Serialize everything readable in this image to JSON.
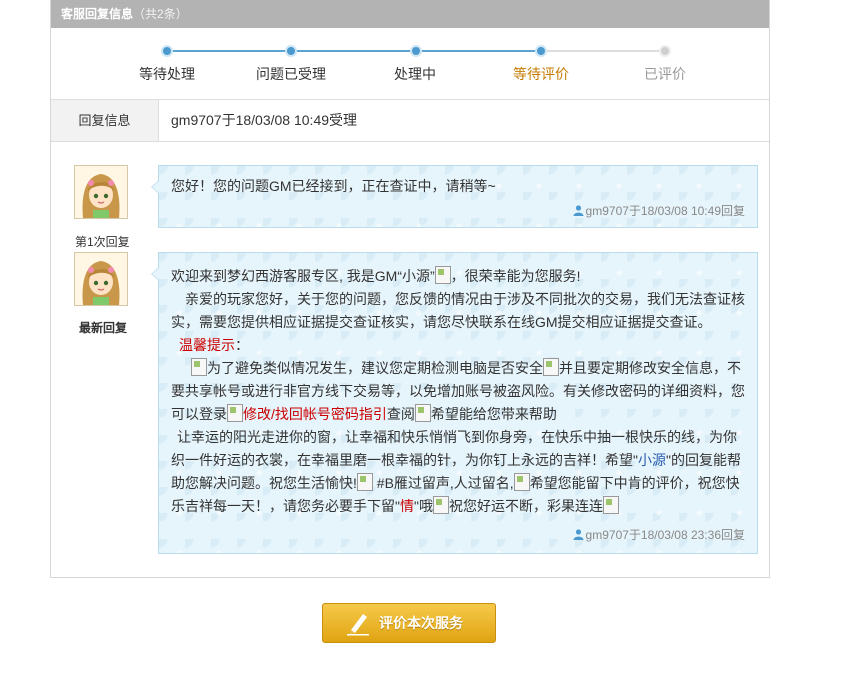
{
  "panel": {
    "title": "客服回复信息",
    "count": "（共2条）"
  },
  "steps": [
    {
      "label": "等待处理",
      "state": "done"
    },
    {
      "label": "问题已受理",
      "state": "done"
    },
    {
      "label": "处理中",
      "state": "done"
    },
    {
      "label": "等待评价",
      "state": "current"
    },
    {
      "label": "已评价",
      "state": "todo"
    }
  ],
  "colors": {
    "current_step": "#c67a00",
    "done_step": "#333333",
    "todo_step": "#999999",
    "progress": "#5ba3d4",
    "todo_line": "#dddddd"
  },
  "info": {
    "label": "回复信息",
    "value": "gm9707于18/03/08 10:49受理"
  },
  "replies": [
    {
      "caption": "第1次回复",
      "text": "您好！您的问题GM已经接到，正在查证中，请稍等~",
      "signature": "gm9707于18/03/08 10:49回复"
    },
    {
      "caption": "最新回复",
      "p1a": "欢迎来到梦幻西游客服专区, 我是GM“小源”",
      "p1b": "，很荣幸能为您服务!",
      "p2": "亲爱的玩家您好，关于您的问题，您反馈的情况由于涉及不同批次的交易，我们无法查证核实，需要您提供相应证据提交查证核实，请您尽快联系在线GM提交相应证据提交查证。",
      "tip": "温馨提示",
      "tip_colon": "：",
      "p3a": "为了避免类似情况发生，建议您定期检测电脑是否安全",
      "p3b": "并且要定期修改安全信息，不要共享帐号或进行非官方线下交易等，以免增加账号被盗风险。有关修改密码的详细资料，您可以登录",
      "p3link": "修改/找回帐号密码指引",
      "p3c": "查阅",
      "p3d": "希望能给您带来帮助",
      "p4a": "让幸运的阳光走进你的窗，让幸福和快乐悄悄飞到你身旁，在快乐中抽一根快乐的线，为你织一件好运的衣裳，在幸福里磨一根幸福的针，为你钉上永远的吉祥！希望\"",
      "p4name": "小源",
      "p4b": "\"的回复能帮助您解决问题。祝您生活愉快!",
      "p4c": " #B雁过留声,人过留名,",
      "p4d": "希望您能留下中肯的评价，祝您快乐吉祥每一天！，请您务必要手下留\"",
      "p4qing": "情",
      "p4e": "\"哦",
      "p4f": "祝您好运不断，彩果连连",
      "signature": "gm9707于18/03/08 23:36回复"
    }
  ],
  "button": {
    "label": "评价本次服务",
    "icon": "pen-icon"
  }
}
